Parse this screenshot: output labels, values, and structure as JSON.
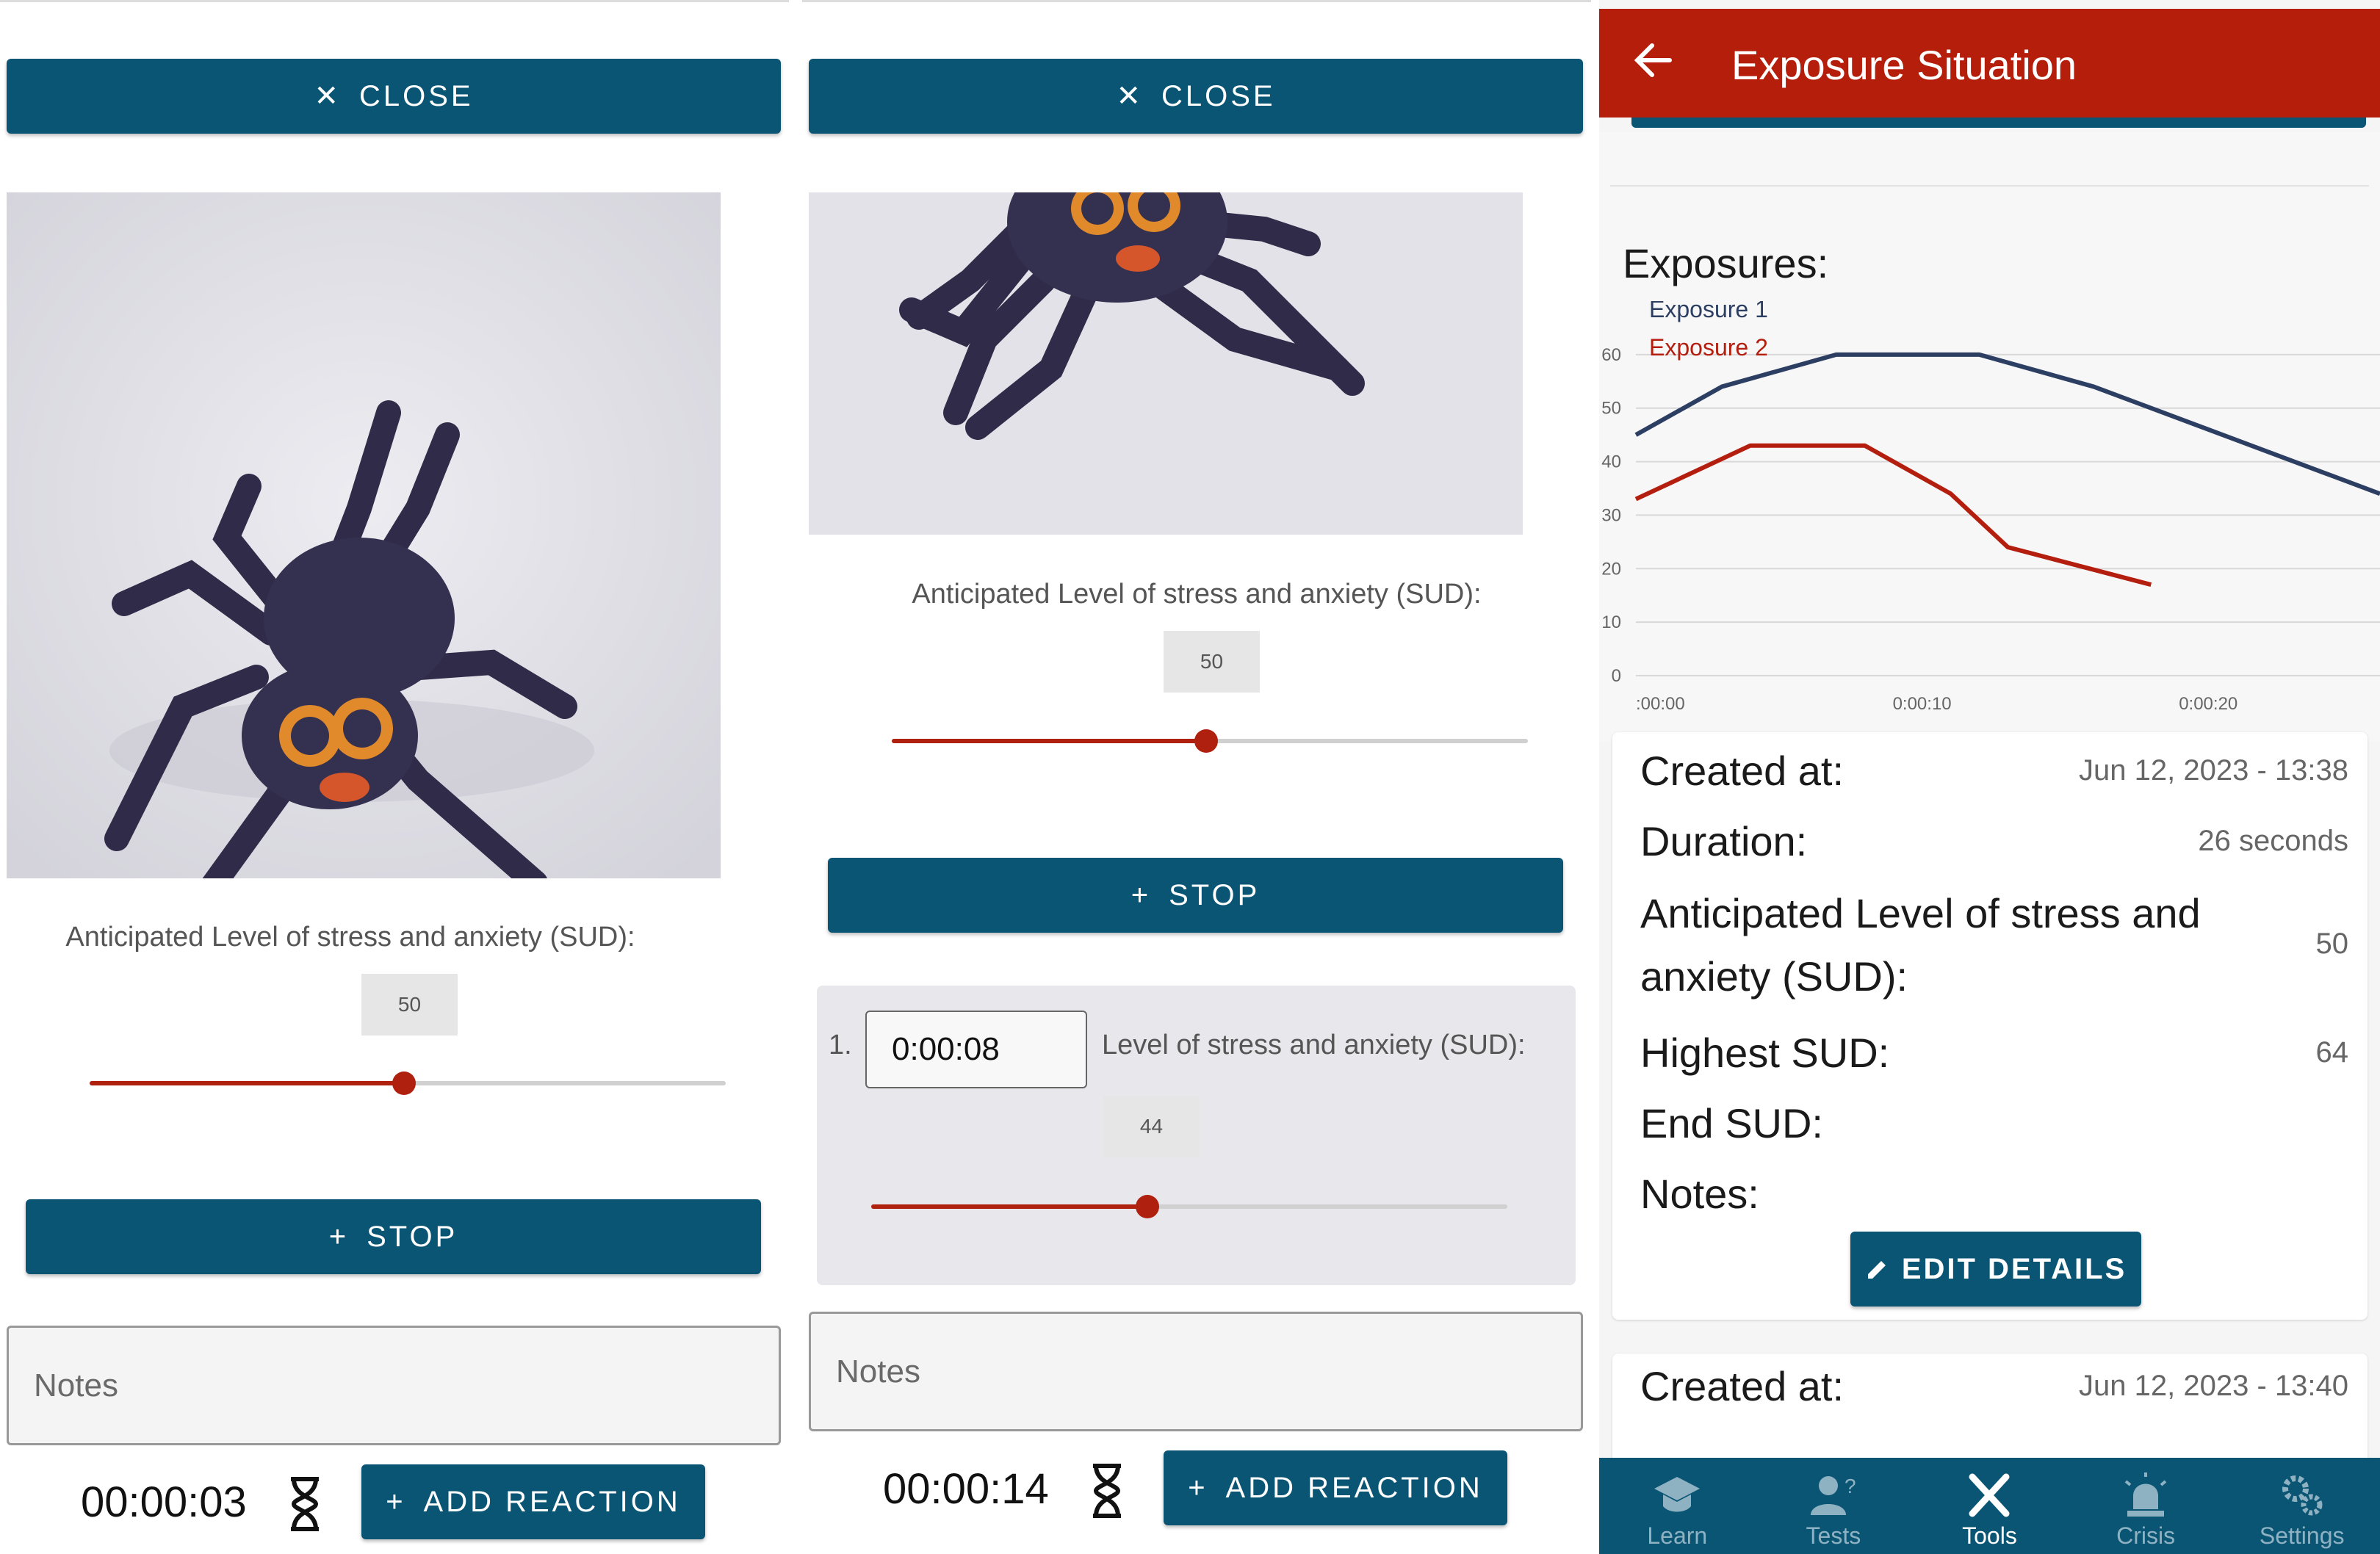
{
  "panels": [
    {
      "close_label": "CLOSE",
      "sud_label": "Anticipated Level of stress and anxiety (SUD):",
      "sud_value": "50",
      "sud_fraction": 0.5,
      "stop_label": "STOP",
      "notes_placeholder": "Notes",
      "timer": "00:00:03",
      "add_reaction_label": "ADD REACTION"
    },
    {
      "close_label": "CLOSE",
      "sud_label": "Anticipated Level of stress and anxiety (SUD):",
      "sud_value": "50",
      "sud_fraction": 0.5,
      "stop_label": "STOP",
      "reaction": {
        "index": "1.",
        "time": "0:00:08",
        "label": "Level of stress and anxiety (SUD):",
        "value": "44",
        "fraction": 0.44
      },
      "notes_placeholder": "Notes",
      "timer": "00:00:14",
      "add_reaction_label": "ADD REACTION"
    }
  ],
  "exposure_screen": {
    "title": "Exposure Situation",
    "exposures_heading": "Exposures:",
    "chart_data": {
      "type": "line",
      "title": "",
      "xlabel": "",
      "ylabel": "",
      "x_tick_labels": [
        ":00:00",
        "0:00:10",
        "0:00:20"
      ],
      "y_ticks": [
        "0",
        "10",
        "20",
        "30",
        "40",
        "50",
        "60"
      ],
      "ylim": [
        0,
        70
      ],
      "xlim": [
        0,
        26
      ],
      "legend_position": "top-left",
      "series": [
        {
          "name": "Exposure 1",
          "color": "#2c3f63",
          "x": [
            0,
            3,
            7,
            12,
            16,
            20,
            24,
            26
          ],
          "y": [
            45,
            54,
            60,
            60,
            54,
            46,
            38,
            34
          ]
        },
        {
          "name": "Exposure 2",
          "color": "#b31e0f",
          "x": [
            0,
            4,
            8,
            11,
            13,
            18
          ],
          "y": [
            33,
            43,
            43,
            34,
            24,
            17
          ]
        }
      ]
    },
    "entry1": {
      "created_label": "Created at:",
      "created_value": "Jun 12, 2023 - 13:38",
      "duration_label": "Duration:",
      "duration_value": "26 seconds",
      "anticipated_label_1": "Anticipated Level of stress and",
      "anticipated_label_2": "anxiety (SUD):",
      "anticipated_value": "50",
      "highest_label": "Highest SUD:",
      "highest_value": "64",
      "end_label": "End SUD:",
      "notes_label": "Notes:",
      "edit_label": "EDIT DETAILS"
    },
    "entry2": {
      "created_label": "Created at:",
      "created_value": "Jun 12, 2023 - 13:40"
    },
    "nav": [
      "Learn",
      "Tests",
      "Tools",
      "Crisis",
      "Settings"
    ],
    "nav_active": "Tools"
  },
  "colors": {
    "primary": "#0a5574",
    "accent_red": "#b41e0b",
    "slider_red": "#b0200f"
  }
}
